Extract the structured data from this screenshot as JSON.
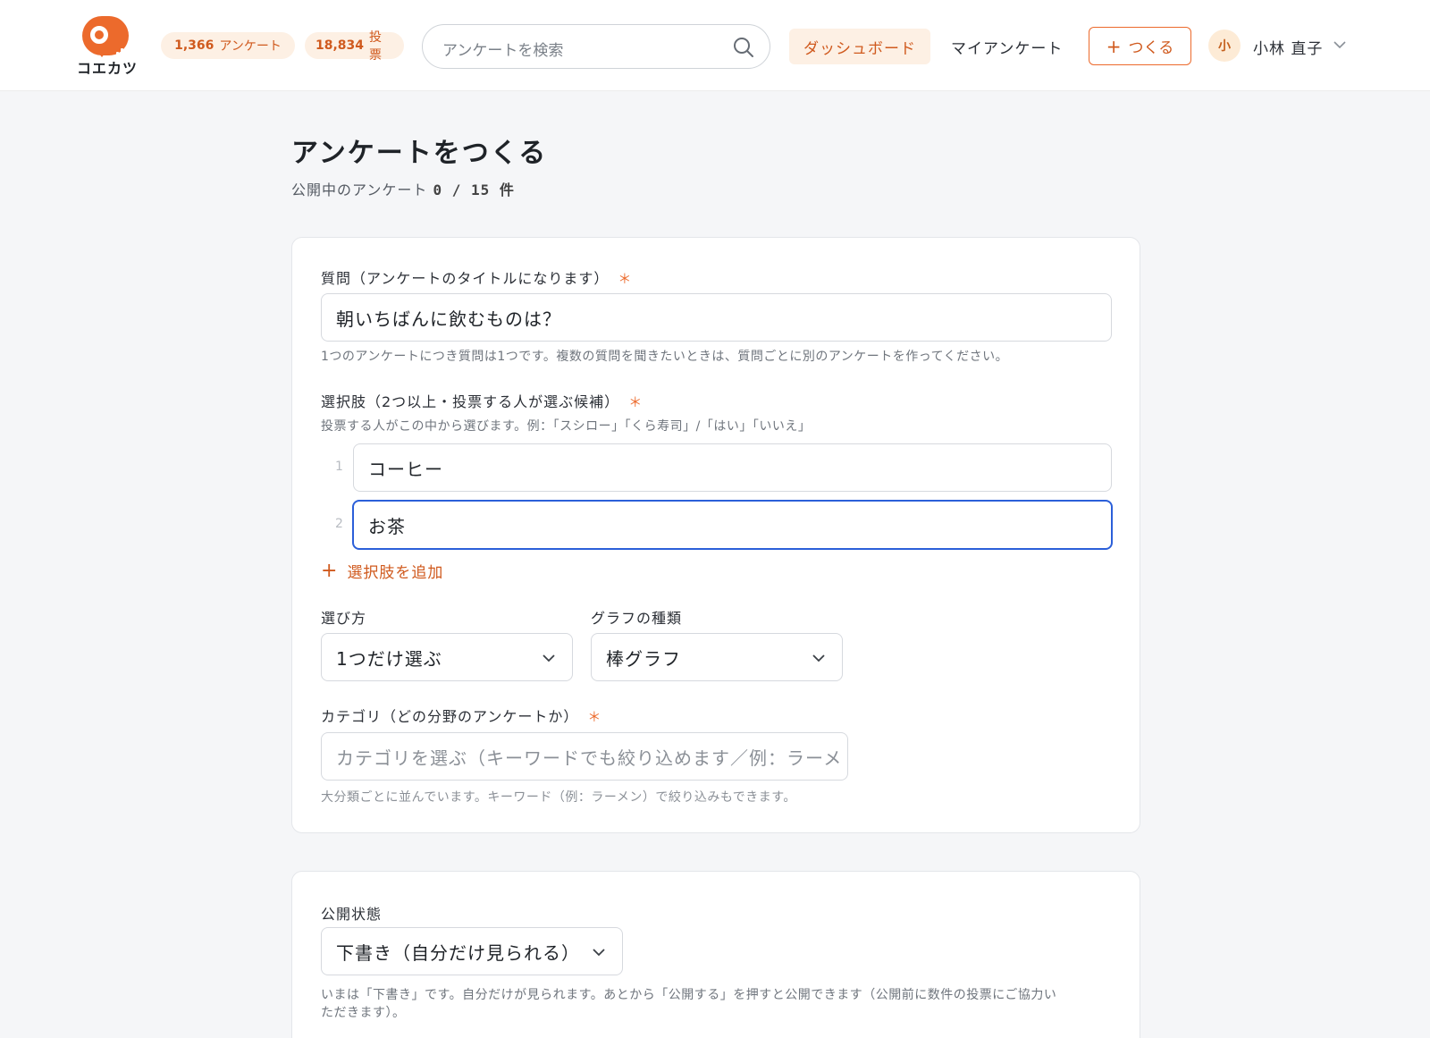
{
  "brand": {
    "name": "コエカツ",
    "color": "#ec6a2c"
  },
  "header": {
    "stats": [
      {
        "value": "1,366",
        "label": "アンケート"
      },
      {
        "value": "18,834",
        "label": "投票"
      }
    ],
    "search": {
      "placeholder": "アンケートを検索",
      "icon": "search-icon"
    },
    "nav": {
      "dashboard": "ダッシュボード",
      "my_surveys": "マイアンケート"
    },
    "create_button": {
      "icon": "plus-icon",
      "label": "つくる"
    },
    "user": {
      "avatar_initial": "小",
      "name": "小林 直子",
      "icon": "chevron-down-icon"
    }
  },
  "page": {
    "title": "アンケートをつくる",
    "subtitle_prefix": "公開中のアンケート",
    "published_count": "0 / 15 件"
  },
  "form": {
    "question": {
      "label": "質問（アンケートのタイトルになります）",
      "required_mark": "＊",
      "value": "朝いちばんに飲むものは？",
      "help": "1つのアンケートにつき質問は1つです。複数の質問を聞きたいときは、質問ごとに別のアンケートを作ってください。"
    },
    "choices": {
      "label": "選択肢（2つ以上・投票する人が選ぶ候補）",
      "required_mark": "＊",
      "help": "投票する人がこの中から選びます。例：「スシロー」「くら寿司」/「はい」「いいえ」",
      "items": [
        {
          "number": "1",
          "value": "コーヒー"
        },
        {
          "number": "2",
          "value": "お茶"
        }
      ],
      "add_label": "選択肢を追加",
      "add_icon": "plus-icon"
    },
    "selection_mode": {
      "label": "選び方",
      "value": "1つだけ選ぶ"
    },
    "graph_type": {
      "label": "グラフの種類",
      "value": "棒グラフ"
    },
    "category": {
      "label": "カテゴリ（どの分野のアンケートか）",
      "required_mark": "＊",
      "placeholder": "カテゴリを選ぶ（キーワードでも絞り込めます／例：ラーメ",
      "help": "大分類ごとに並んでいます。キーワード（例：ラーメン）で絞り込みもできます。"
    },
    "visibility": {
      "label": "公開状態",
      "value": "下書き（自分だけ見られる）",
      "help_line1": "いまは「下書き」です。自分だけが見られます。あとから「公開する」を押すと公開できます（公開前に数件の投票にご協力い",
      "help_line2": "ただきます）。"
    }
  },
  "colors": {
    "accent": "#ec6a2c",
    "accent_text": "#d05a1e",
    "accent_bg": "#fdf0e4",
    "focus": "#2b5fd9"
  }
}
